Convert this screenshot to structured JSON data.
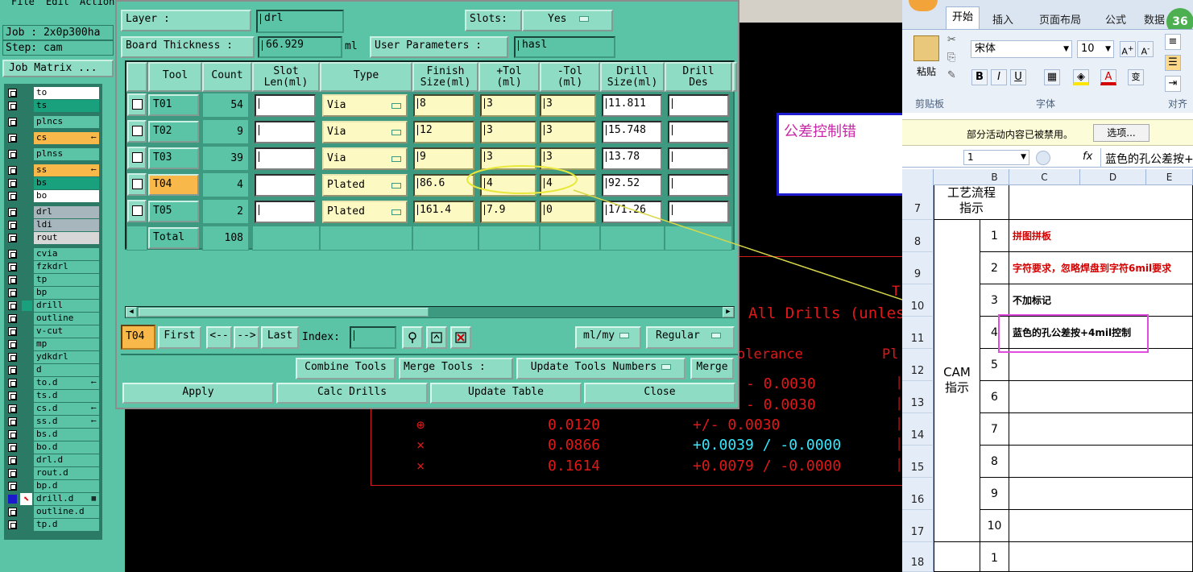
{
  "cad": {
    "menu": [
      "File",
      "Edit",
      "Action"
    ],
    "job_label": "Job : 2x0p300ha",
    "step_label": "Step: cam",
    "job_matrix_button": "Job Matrix ...",
    "layers": [
      {
        "name": "to",
        "style": "white",
        "mark": "",
        "gap": 0
      },
      {
        "name": "ts",
        "style": "green",
        "mark": "",
        "gap": 0
      },
      {
        "name": "plncs",
        "style": "normal",
        "mark": "",
        "gap": 1
      },
      {
        "name": "cs",
        "style": "orange",
        "mark": "⟵",
        "gap": 1
      },
      {
        "name": "plnss",
        "style": "normal",
        "mark": "",
        "gap": 1
      },
      {
        "name": "ss",
        "style": "orange",
        "mark": "⟵",
        "gap": 1
      },
      {
        "name": "bs",
        "style": "green",
        "mark": "",
        "gap": 0
      },
      {
        "name": "bo",
        "style": "white",
        "mark": "",
        "gap": 0
      },
      {
        "name": "drl",
        "style": "gray",
        "mark": "",
        "gap": 1
      },
      {
        "name": "ldi",
        "style": "gray",
        "mark": "",
        "gap": 0
      },
      {
        "name": "rout",
        "style": "lightgray",
        "mark": "",
        "gap": 0
      },
      {
        "name": "cvia",
        "style": "normal",
        "mark": "",
        "gap": 1
      },
      {
        "name": "fzkdrl",
        "style": "normal",
        "mark": "",
        "gap": 0
      },
      {
        "name": "tp",
        "style": "normal",
        "mark": "",
        "gap": 0
      },
      {
        "name": "bp",
        "style": "normal",
        "mark": "",
        "gap": 0
      },
      {
        "name": "drill",
        "style": "normal",
        "mark": "",
        "gap": 0,
        "active": true
      },
      {
        "name": "outline",
        "style": "normal",
        "mark": "",
        "gap": 0
      },
      {
        "name": "v-cut",
        "style": "normal",
        "mark": "",
        "gap": 0
      },
      {
        "name": "mp",
        "style": "normal",
        "mark": "",
        "gap": 0
      },
      {
        "name": "ydkdrl",
        "style": "normal",
        "mark": "",
        "gap": 0
      },
      {
        "name": "d",
        "style": "normal",
        "mark": "",
        "gap": 0
      },
      {
        "name": "to.d",
        "style": "normal",
        "mark": "⟵",
        "gap": 0
      },
      {
        "name": "ts.d",
        "style": "normal",
        "mark": "",
        "gap": 0
      },
      {
        "name": "cs.d",
        "style": "normal",
        "mark": "⟵",
        "gap": 0
      },
      {
        "name": "ss.d",
        "style": "normal",
        "mark": "⟵",
        "gap": 0
      },
      {
        "name": "bs.d",
        "style": "normal",
        "mark": "",
        "gap": 0
      },
      {
        "name": "bo.d",
        "style": "normal",
        "mark": "",
        "gap": 0
      },
      {
        "name": "drl.d",
        "style": "normal",
        "mark": "",
        "gap": 0
      },
      {
        "name": "rout.d",
        "style": "normal",
        "mark": "",
        "gap": 0
      },
      {
        "name": "bp.d",
        "style": "normal",
        "mark": "",
        "gap": 0
      },
      {
        "name": "drill.d",
        "style": "normal",
        "mark": "▦",
        "gap": 0,
        "work": true
      },
      {
        "name": "outline.d",
        "style": "normal",
        "mark": "",
        "gap": 0
      },
      {
        "name": "tp.d",
        "style": "normal",
        "mark": "",
        "gap": 0
      }
    ],
    "drawing": {
      "header_all_drills": "All Drills (unles",
      "header_tolerance": "olerance",
      "header_pl": "Pl",
      "header_t": "T",
      "rows": [
        {
          "symbol": "",
          "size": "",
          "tol": "- 0.0030",
          "tol_color": "red"
        },
        {
          "symbol": "",
          "size": "",
          "tol": "- 0.0030",
          "tol_color": "red"
        },
        {
          "symbol": "⊕",
          "size": "0.0120",
          "tol": "+/- 0.0030",
          "tol_color": "red"
        },
        {
          "symbol": "⨯",
          "size": "0.0866",
          "tol": "+0.0039 / -0.0000",
          "tol_color": "cyan"
        },
        {
          "symbol": "⨯",
          "size": "0.1614",
          "tol": "+0.0079 / -0.0000",
          "tol_color": "red"
        }
      ]
    }
  },
  "dialog": {
    "layer_label": "Layer            :",
    "layer_value": "drl",
    "slots_label": "Slots:",
    "slots_value": "Yes",
    "board_thickness_label": "Board Thickness  :",
    "board_thickness_value": "66.929",
    "board_thickness_unit": "ml",
    "user_params_label": "User Parameters  :",
    "user_params_value": "hasl",
    "columns": [
      "Tool",
      "Count",
      "Slot\nLen(ml)",
      "Type",
      "Finish\nSize(ml)",
      "+Tol\n(ml)",
      "-Tol\n(ml)",
      "Drill\nSize(ml)",
      "Drill\nDes"
    ],
    "rows": [
      {
        "tool": "T01",
        "count": "54",
        "type": "Via",
        "finish": "8",
        "ptol": "3",
        "ntol": "3",
        "drill": "11.811",
        "selected": false
      },
      {
        "tool": "T02",
        "count": "9",
        "type": "Via",
        "finish": "12",
        "ptol": "3",
        "ntol": "3",
        "drill": "15.748",
        "selected": false
      },
      {
        "tool": "T03",
        "count": "39",
        "type": "Via",
        "finish": "9",
        "ptol": "3",
        "ntol": "3",
        "drill": "13.78",
        "selected": false
      },
      {
        "tool": "T04",
        "count": "4",
        "type": "Plated",
        "finish": "86.6",
        "ptol": "4",
        "ntol": "4",
        "drill": "92.52",
        "selected": true
      },
      {
        "tool": "T05",
        "count": "2",
        "type": "Plated",
        "finish": "161.4",
        "ptol": "7.9",
        "ntol": "0",
        "drill": "171.26",
        "selected": false
      }
    ],
    "total_label": "Total",
    "total_value": "108",
    "current_tool": "T04",
    "nav": {
      "first": "First",
      "prev": "<--",
      "next": "-->",
      "last": "Last",
      "index_label": "Index:"
    },
    "units_value": "ml/my",
    "mode_value": "Regular",
    "combine_tools": "Combine Tools",
    "merge_tools_label": "Merge Tools  :",
    "update_tools_numbers": "Update Tools Numbers",
    "merge": "Merge",
    "apply": "Apply",
    "calc_drills": "Calc Drills",
    "update_table": "Update Table",
    "close": "Close"
  },
  "annotation": {
    "note": "公差控制错",
    "note_color": "#c628a6"
  },
  "excel": {
    "badge": "36",
    "tabs": [
      "开始",
      "插入",
      "页面布局",
      "公式",
      "数据"
    ],
    "paste_label": "粘贴",
    "font_name": "宋体",
    "font_size": "10",
    "groups": {
      "clipboard": "剪贴板",
      "font": "字体",
      "align": "对齐"
    },
    "security_message": "部分活动内容已被禁用。",
    "options_button": "选项...",
    "name_box": "1",
    "fx": "fx",
    "formula_content": "蓝色的孔公差按+",
    "columns": [
      "B",
      "C",
      "D",
      "E"
    ],
    "row_numbers": [
      "7",
      "8",
      "9",
      "10",
      "11",
      "12",
      "13",
      "14",
      "15",
      "16",
      "17",
      "18"
    ],
    "process_label": "工艺流程\n指示",
    "cam_label": "CAM\n指示",
    "items": [
      {
        "num": "1",
        "text": "拼图拼板",
        "red": true
      },
      {
        "num": "2",
        "text": "字符要求，忽略焊盘到字符6mil要求",
        "red": true
      },
      {
        "num": "3",
        "text": "不加标记",
        "red": false
      },
      {
        "num": "4",
        "text": "蓝色的孔公差按+4mil控制",
        "red": false,
        "highlight": true
      },
      {
        "num": "5",
        "text": "",
        "red": false
      },
      {
        "num": "6",
        "text": "",
        "red": false
      },
      {
        "num": "7",
        "text": "",
        "red": false
      },
      {
        "num": "8",
        "text": "",
        "red": false
      },
      {
        "num": "9",
        "text": "",
        "red": false
      },
      {
        "num": "10",
        "text": "",
        "red": false
      }
    ],
    "last_num": "1"
  }
}
